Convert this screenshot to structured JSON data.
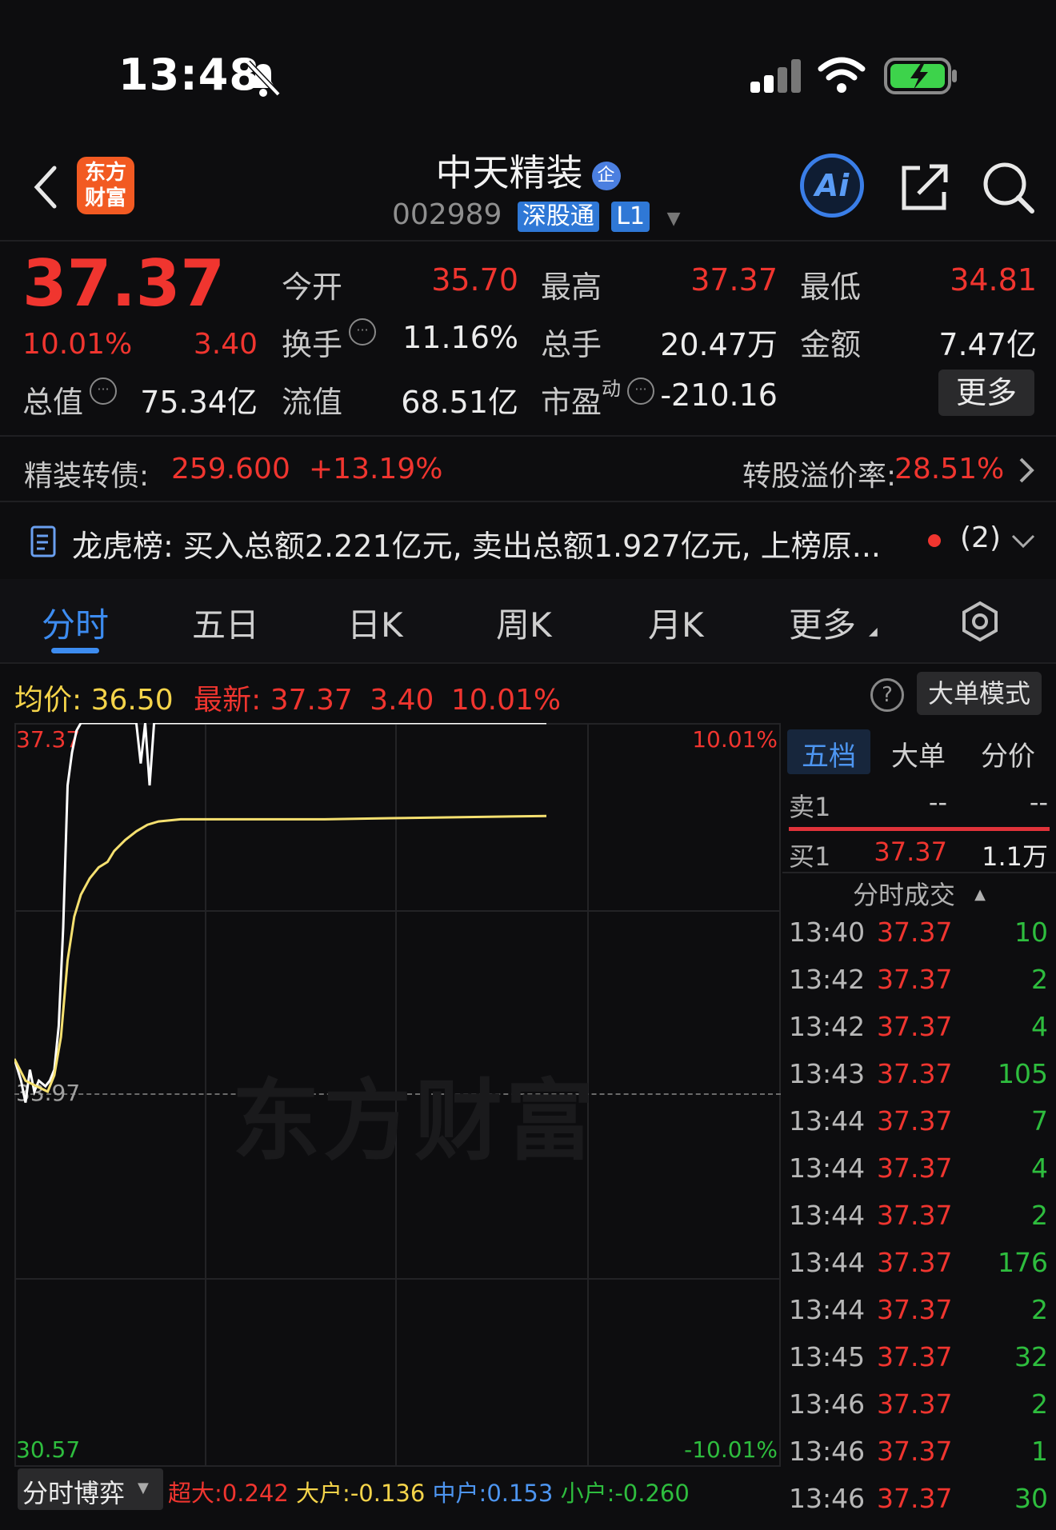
{
  "status_bar": {
    "time": "13:48"
  },
  "header": {
    "back": "<",
    "logo_line1": "东方",
    "logo_line2": "财富",
    "title": "中天精装",
    "badge": "企",
    "code": "002989",
    "tag1": "深股通",
    "tag2": "L1",
    "ai_label": "Ai"
  },
  "quote": {
    "price": "37.37",
    "change_pct": "10.01%",
    "change": "3.40",
    "open_label": "今开",
    "open": "35.70",
    "high_label": "最高",
    "high": "37.37",
    "low_label": "最低",
    "low": "34.81",
    "turnover_label": "换手",
    "turnover": "11.16%",
    "volume_label": "总手",
    "volume": "20.47万",
    "amount_label": "金额",
    "amount": "7.47亿",
    "mktcap_label": "总值",
    "mktcap": "75.34亿",
    "float_label": "流值",
    "float": "68.51亿",
    "pe_label": "市盈",
    "pe_sup": "动",
    "pe": "-210.16",
    "more": "更多"
  },
  "bond": {
    "label": "精装转债:",
    "price": "259.600",
    "change": "+13.19%",
    "premium_label": "转股溢价率:",
    "premium": "28.51%"
  },
  "notice": {
    "text": "龙虎榜: 买入总额2.221亿元, 卖出总额1.927亿元, 上榜原...",
    "count": "(2)"
  },
  "tabs": [
    "分时",
    "五日",
    "日K",
    "周K",
    "月K",
    "更多"
  ],
  "chart_info": {
    "avg_label": "均价:",
    "avg": "36.50",
    "latest_label": "最新:",
    "latest": "37.37",
    "latest_change": "3.40",
    "latest_pct": "10.01%",
    "mode_btn": "大单模式"
  },
  "chart_data": {
    "type": "line",
    "y_top": "37.37",
    "y_mid": "33.97",
    "y_bottom": "30.57",
    "pct_top": "10.01%",
    "pct_bottom": "-10.01%",
    "ylim": [
      30.57,
      37.37
    ],
    "x_range": [
      0,
      240
    ],
    "series": [
      {
        "color": "#ffffff",
        "points": [
          [
            0,
            34.3
          ],
          [
            3,
            34.1
          ],
          [
            5,
            33.9
          ],
          [
            7,
            34.2
          ],
          [
            9,
            34.0
          ],
          [
            11,
            34.1
          ],
          [
            14,
            34.05
          ],
          [
            16,
            34.1
          ],
          [
            18,
            34.2
          ],
          [
            20,
            34.6
          ],
          [
            22,
            35.5
          ],
          [
            24,
            36.8
          ],
          [
            26,
            37.1
          ],
          [
            28,
            37.3
          ],
          [
            30,
            37.37
          ],
          [
            55,
            37.37
          ],
          [
            57,
            37.0
          ],
          [
            59,
            37.37
          ],
          [
            61,
            36.8
          ],
          [
            63,
            37.37
          ],
          [
            140,
            37.37
          ],
          [
            240,
            37.37
          ]
        ]
      },
      {
        "color": "#f5e070",
        "points": [
          [
            0,
            34.3
          ],
          [
            5,
            34.1
          ],
          [
            10,
            34.05
          ],
          [
            15,
            34.0
          ],
          [
            18,
            34.15
          ],
          [
            21,
            34.5
          ],
          [
            24,
            35.2
          ],
          [
            27,
            35.6
          ],
          [
            30,
            35.8
          ],
          [
            34,
            35.95
          ],
          [
            38,
            36.05
          ],
          [
            42,
            36.1
          ],
          [
            45,
            36.2
          ],
          [
            50,
            36.3
          ],
          [
            55,
            36.38
          ],
          [
            60,
            36.44
          ],
          [
            65,
            36.47
          ],
          [
            75,
            36.49
          ],
          [
            100,
            36.49
          ],
          [
            140,
            36.49
          ],
          [
            170,
            36.5
          ],
          [
            240,
            36.52
          ]
        ]
      }
    ]
  },
  "watermark": "东方财富",
  "orderbook": {
    "tabs": [
      "五档",
      "大单",
      "分价"
    ],
    "sell_label": "卖1",
    "sell_price": "--",
    "sell_vol": "--",
    "buy_label": "买1",
    "buy_price": "37.37",
    "buy_vol": "1.1万",
    "ticks_header": "分时成交"
  },
  "ticks": [
    {
      "t": "13:40",
      "p": "37.37",
      "v": "10"
    },
    {
      "t": "13:42",
      "p": "37.37",
      "v": "2"
    },
    {
      "t": "13:42",
      "p": "37.37",
      "v": "4"
    },
    {
      "t": "13:43",
      "p": "37.37",
      "v": "105"
    },
    {
      "t": "13:44",
      "p": "37.37",
      "v": "7"
    },
    {
      "t": "13:44",
      "p": "37.37",
      "v": "4"
    },
    {
      "t": "13:44",
      "p": "37.37",
      "v": "2"
    },
    {
      "t": "13:44",
      "p": "37.37",
      "v": "176"
    },
    {
      "t": "13:44",
      "p": "37.37",
      "v": "2"
    },
    {
      "t": "13:45",
      "p": "37.37",
      "v": "32"
    },
    {
      "t": "13:46",
      "p": "37.37",
      "v": "2"
    },
    {
      "t": "13:46",
      "p": "37.37",
      "v": "1"
    },
    {
      "t": "13:46",
      "p": "37.37",
      "v": "30"
    }
  ],
  "game": {
    "btn": "分时博弈",
    "super_label": "超大:",
    "super": "0.242",
    "big_label": "大户:",
    "big": "-0.136",
    "mid_label": "中户:",
    "mid": "0.153",
    "small_label": "小户:",
    "small": "-0.260"
  }
}
